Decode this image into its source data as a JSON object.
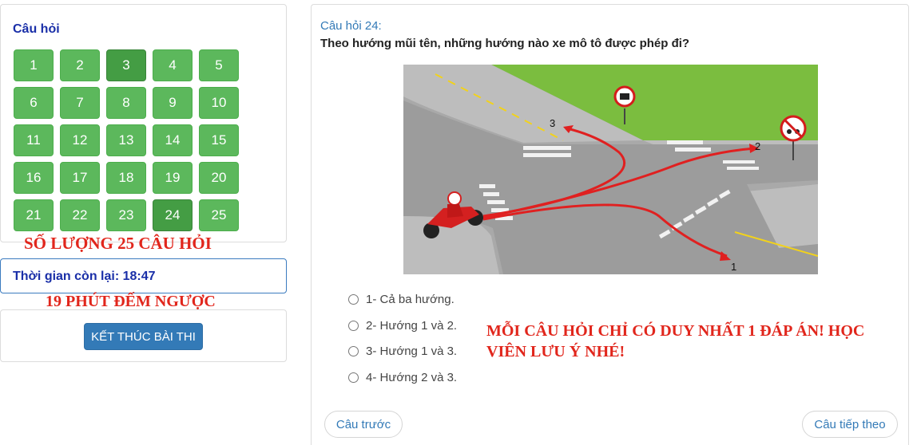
{
  "sidebar": {
    "title": "Câu hỏi",
    "questions": [
      "1",
      "2",
      "3",
      "4",
      "5",
      "6",
      "7",
      "8",
      "9",
      "10",
      "11",
      "12",
      "13",
      "14",
      "15",
      "16",
      "17",
      "18",
      "19",
      "20",
      "21",
      "22",
      "23",
      "24",
      "25"
    ],
    "active_questions": [
      "3",
      "24"
    ],
    "count_note": "SỐ LƯỢNG 25 CÂU HỎI",
    "timer_label": "Thời gian còn lại: 18:47",
    "timer_note": "19 PHÚT ĐẾM NGƯỢC",
    "finish_label": "KẾT THÚC BÀI THI"
  },
  "question": {
    "number_label": "Câu hỏi 24:",
    "text": "Theo hướng mũi tên, những hướng nào xe mô tô được phép đi?",
    "image_labels": [
      "1",
      "2",
      "3"
    ],
    "answers": [
      "1- Cả ba hướng.",
      "2- Hướng 1 và 2.",
      "3- Hướng 1 và 3.",
      "4- Hướng 2 và 3."
    ],
    "rule_note": "MỖI CÂU HỎI CHỈ CÓ DUY NHẤT 1 ĐÁP ÁN! HỌC VIÊN LƯU Ý NHÉ!"
  },
  "nav": {
    "prev_label": "Câu trước",
    "next_label": "Câu tiếp theo"
  },
  "colors": {
    "question_button": "#5cb85c",
    "question_button_active": "#449d44",
    "finish_button": "#337ab7",
    "heading_blue": "#1a2fa8",
    "note_red": "#e1261c",
    "arrow_red": "#e02020",
    "grass": "#7bbd3f"
  }
}
